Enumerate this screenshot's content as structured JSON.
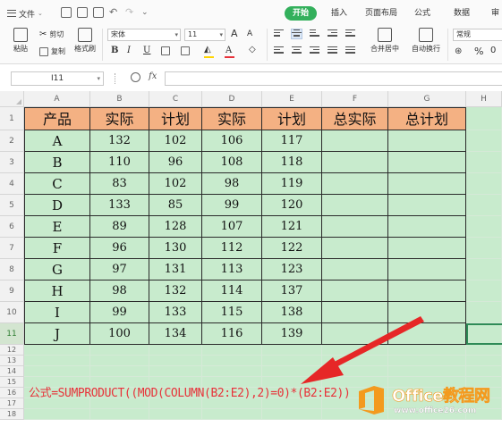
{
  "ribbon": {
    "file_menu": "文件",
    "tabs": [
      "开始",
      "插入",
      "页面布局",
      "公式",
      "数据",
      "审"
    ],
    "paste": "粘贴",
    "cut": "剪切",
    "copy": "复制",
    "format_painter": "格式刷",
    "font_name": "宋体",
    "font_size": "11",
    "bold": "B",
    "italic": "I",
    "underline": "U",
    "font_color": "A",
    "increase_font": "A",
    "decrease_font": "A",
    "merge_center": "合并居中",
    "wrap_text": "自动换行",
    "number_format": "常规",
    "percent": "%",
    "thousands": "0",
    "colors": {
      "active_tab": "#33b05c",
      "font_color_bar": "#e8323a",
      "fill_color_bar": "#ffd400"
    }
  },
  "formula_bar": {
    "name_box": "I11",
    "fx_label": "fx",
    "formula": ""
  },
  "grid": {
    "columns": [
      "A",
      "B",
      "C",
      "D",
      "E",
      "F",
      "G",
      "H"
    ],
    "rows": [
      "1",
      "2",
      "3",
      "4",
      "5",
      "6",
      "7",
      "8",
      "9",
      "10",
      "11",
      "12",
      "13",
      "14",
      "15",
      "16",
      "17",
      "18"
    ],
    "selected_row": "11",
    "headers": [
      "产品",
      "实际",
      "计划",
      "实际",
      "计划",
      "总实际",
      "总计划"
    ],
    "data": [
      [
        "A",
        "132",
        "102",
        "106",
        "117",
        "",
        ""
      ],
      [
        "B",
        "110",
        "96",
        "108",
        "118",
        "",
        ""
      ],
      [
        "C",
        "83",
        "102",
        "98",
        "119",
        "",
        ""
      ],
      [
        "D",
        "133",
        "85",
        "99",
        "120",
        "",
        ""
      ],
      [
        "E",
        "89",
        "128",
        "107",
        "121",
        "",
        ""
      ],
      [
        "F",
        "96",
        "130",
        "112",
        "122",
        "",
        ""
      ],
      [
        "G",
        "97",
        "131",
        "113",
        "123",
        "",
        ""
      ],
      [
        "H",
        "98",
        "132",
        "114",
        "137",
        "",
        ""
      ],
      [
        "I",
        "99",
        "133",
        "115",
        "138",
        "",
        ""
      ],
      [
        "J",
        "100",
        "134",
        "116",
        "139",
        "",
        ""
      ]
    ],
    "colors": {
      "header_fill": "#f4b183",
      "cell_fill": "#c8ebcd",
      "border": "#2a2a2a"
    }
  },
  "annotation": {
    "formula_text": "公式=SUMPRODUCT((MOD(COLUMN(B2:E2),2)=0)*(B2:E2))",
    "color": "#e8323a"
  },
  "watermark": {
    "title": "Office教程网",
    "url": "www.office26.com"
  }
}
